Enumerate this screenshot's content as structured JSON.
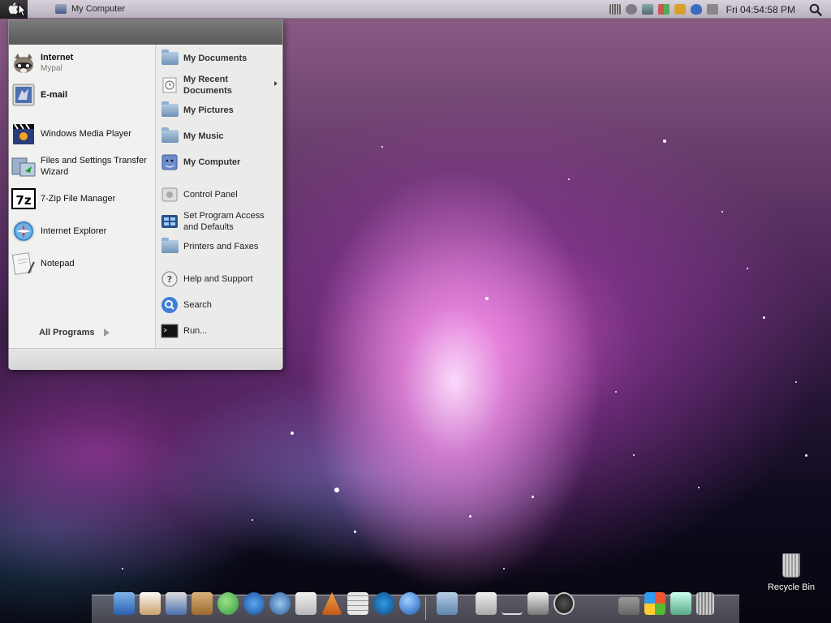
{
  "menubar": {
    "window_title": "My Computer",
    "clock": "Fri 04:54:58 PM",
    "apple_icon": "apple-icon",
    "search_icon": "search-icon"
  },
  "start_menu": {
    "left_items": [
      {
        "label": "Internet",
        "sub": "Mypal",
        "bold": true,
        "icon": "raccoon-browser-icon"
      },
      {
        "label": "E-mail",
        "sub": "",
        "bold": true,
        "icon": "mail-stamp-icon"
      },
      {
        "label": "Windows Media Player",
        "sub": "",
        "bold": false,
        "icon": "clapperboard-icon"
      },
      {
        "label": "Files and Settings Transfer",
        "sub": "Wizard",
        "bold": false,
        "icon": "transfer-wizard-icon"
      },
      {
        "label": "7-Zip File Manager",
        "sub": "",
        "bold": false,
        "icon": "7zip-icon"
      },
      {
        "label": "Internet Explorer",
        "sub": "",
        "bold": false,
        "icon": "compass-icon"
      },
      {
        "label": "Notepad",
        "sub": "",
        "bold": false,
        "icon": "notepad-icon"
      }
    ],
    "all_programs": "All Programs",
    "right_items": [
      {
        "label": "My Documents",
        "bold": true,
        "icon": "documents-folder-icon"
      },
      {
        "label": "My Recent Documents",
        "bold": true,
        "icon": "recent-documents-icon",
        "has_submenu": true
      },
      {
        "label": "My Pictures",
        "bold": true,
        "icon": "pictures-folder-icon"
      },
      {
        "label": "My Music",
        "bold": true,
        "icon": "music-folder-icon"
      },
      {
        "label": "My Computer",
        "bold": true,
        "icon": "computer-icon"
      },
      {
        "label": "Control Panel",
        "bold": false,
        "icon": "control-panel-icon"
      },
      {
        "label": "Set Program Access and Defaults",
        "bold": false,
        "icon": "program-defaults-icon"
      },
      {
        "label": "Printers and Faxes",
        "bold": false,
        "icon": "printer-folder-icon"
      },
      {
        "label": "Help and Support",
        "bold": false,
        "icon": "help-icon"
      },
      {
        "label": "Search",
        "bold": false,
        "icon": "search-icon"
      },
      {
        "label": "Run...",
        "bold": false,
        "icon": "run-terminal-icon"
      }
    ]
  },
  "desktop": {
    "recycle_bin": "Recycle Bin"
  },
  "dock": {
    "items": [
      "finder-icon",
      "home-icon",
      "mail-icon",
      "address-book-icon",
      "messenger-icon",
      "media-player-icon",
      "browser-icon",
      "notes-icon",
      "app-store-icon",
      "calculator-icon",
      "media-center-icon",
      "globe-icon",
      "folder-icon",
      "scissors-icon",
      "hanger-icon",
      "system-settings-icon",
      "power-icon",
      "dropdown-icon",
      "windows-logo-icon",
      "downloads-icon",
      "trash-icon"
    ]
  },
  "colors": {
    "menubar_bg": "#c9c1cc",
    "startmenu_header": "#6a6a6a",
    "startmenu_bg": "#f0f0ef"
  }
}
